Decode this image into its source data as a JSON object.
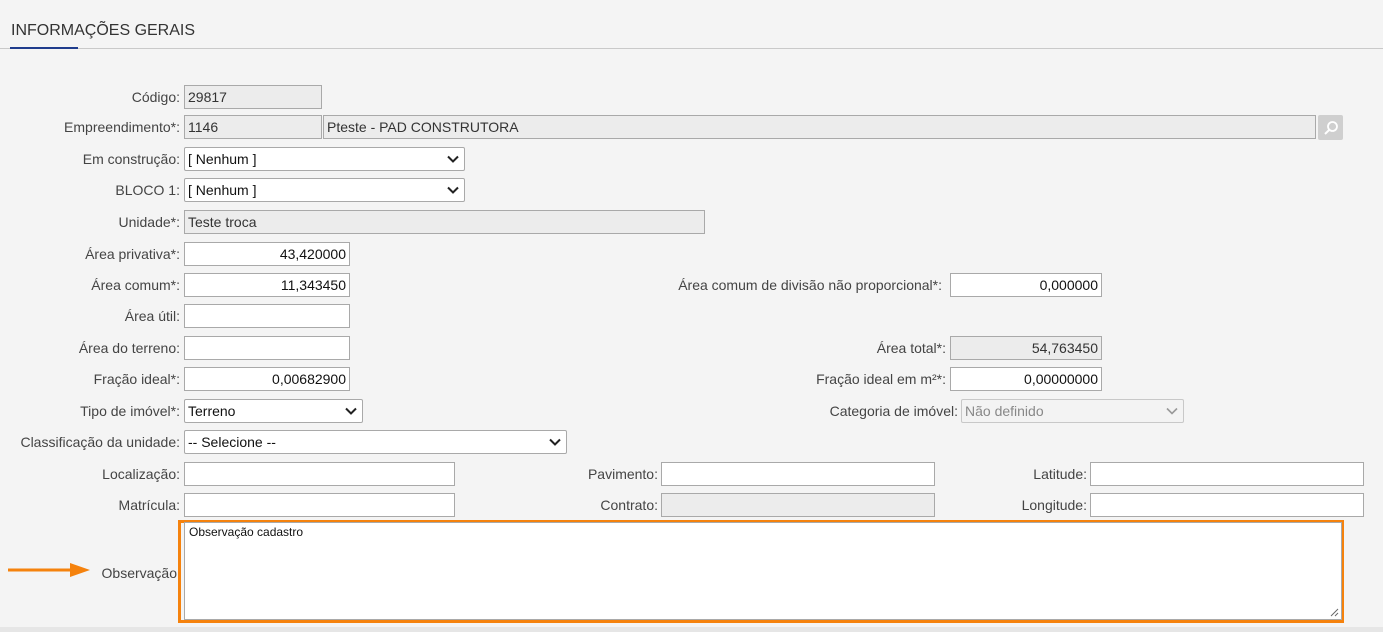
{
  "section": {
    "title": "INFORMAÇÕES GERAIS"
  },
  "labels": {
    "codigo": "Código:",
    "empreendimento": "Empreendimento*:",
    "em_construcao": "Em construção:",
    "bloco": "BLOCO 1:",
    "unidade": "Unidade*:",
    "area_privativa": "Área privativa*:",
    "area_comum": "Área comum*:",
    "area_comum_div": "Área comum de divisão não proporcional*:",
    "area_util": "Área útil:",
    "area_terreno": "Área do terreno:",
    "area_total": "Área total*:",
    "fracao_ideal": "Fração ideal*:",
    "fracao_ideal_m2": "Fração ideal em m²*:",
    "tipo_imovel": "Tipo de imóvel*:",
    "categoria_imovel": "Categoria de imóvel:",
    "classificacao": "Classificação da unidade:",
    "localizacao": "Localização:",
    "pavimento": "Pavimento:",
    "latitude": "Latitude:",
    "matricula": "Matrícula:",
    "contrato": "Contrato:",
    "longitude": "Longitude:",
    "observacao": "Observação"
  },
  "values": {
    "codigo": "29817",
    "empreendimento_code": "1146",
    "empreendimento_name": "Pteste - PAD CONSTRUTORA",
    "em_construcao": "[ Nenhum ]",
    "bloco": "[ Nenhum ]",
    "unidade": "Teste troca",
    "area_privativa": "43,420000",
    "area_comum": "11,343450",
    "area_comum_div": "0,000000",
    "area_util": "",
    "area_terreno": "",
    "area_total": "54,763450",
    "fracao_ideal": "0,00682900",
    "fracao_ideal_m2": "0,00000000",
    "tipo_imovel": "Terreno",
    "categoria_imovel": "Não definido",
    "classificacao": "-- Selecione --",
    "localizacao": "",
    "pavimento": "",
    "latitude": "",
    "matricula": "",
    "contrato": "",
    "longitude": "",
    "observacao": "Observação cadastro"
  },
  "colors": {
    "highlight": "#f5820d",
    "accent": "#1f3c8c"
  }
}
